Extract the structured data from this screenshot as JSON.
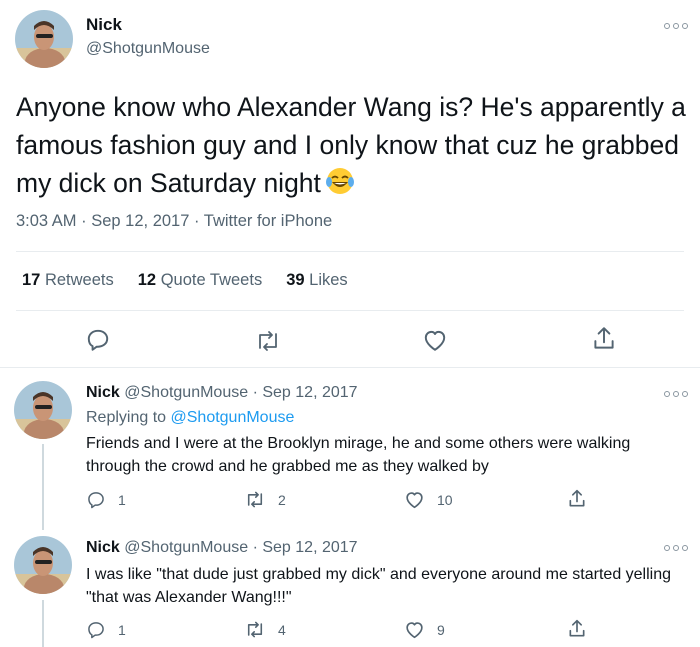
{
  "main_tweet": {
    "author_name": "Nick",
    "author_handle": "@ShotgunMouse",
    "text": "Anyone know who Alexander Wang is? He's apparently a famous fashion guy and I only know that cuz he grabbed my dick on Saturday night",
    "emoji": "face-with-tears-of-joy",
    "time": "3:03 AM",
    "date": "Sep 12, 2017",
    "source": "Twitter for iPhone",
    "separator": "·",
    "retweets_count": "17",
    "retweets_label": "Retweets",
    "quote_count": "12",
    "quote_label": "Quote Tweets",
    "likes_count": "39",
    "likes_label": "Likes"
  },
  "replies": [
    {
      "author_name": "Nick",
      "author_handle": "@ShotgunMouse",
      "separator": "·",
      "date": "Sep 12, 2017",
      "replying_prefix": "Replying to",
      "replying_handle": "@ShotgunMouse",
      "text": "Friends and I were at the Brooklyn mirage, he and some others were walking through the crowd and he grabbed me as they walked by",
      "reply_count": "1",
      "retweet_count": "2",
      "like_count": "10"
    },
    {
      "author_name": "Nick",
      "author_handle": "@ShotgunMouse",
      "separator": "·",
      "date": "Sep 12, 2017",
      "text": "I was like \"that dude just grabbed my dick\" and everyone around me started yelling \"that was Alexander Wang!!!\"",
      "reply_count": "1",
      "retweet_count": "4",
      "like_count": "9"
    }
  ],
  "colors": {
    "text": "#0f1419",
    "secondary": "#536471",
    "link": "#1d9bf0",
    "divider": "#e8ecef"
  }
}
